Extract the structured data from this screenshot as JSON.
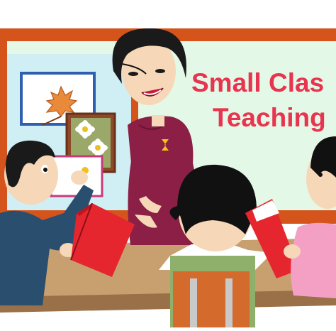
{
  "caption": {
    "line1": "Small Clas",
    "line2": "Teaching"
  },
  "colors": {
    "board_frame": "#d4541c",
    "board_fill": "#e4f8e8",
    "left_panel": "#cfeff4",
    "teacher_dress": "#8b1f45",
    "skin": "#f6d8b8",
    "desk": "#c8a070",
    "book_red": "#e5262f",
    "caption_red": "#e8344e"
  },
  "icons": [
    "oak-leaf-picture",
    "daisy-flowers-picture",
    "hourglass-brooch"
  ]
}
